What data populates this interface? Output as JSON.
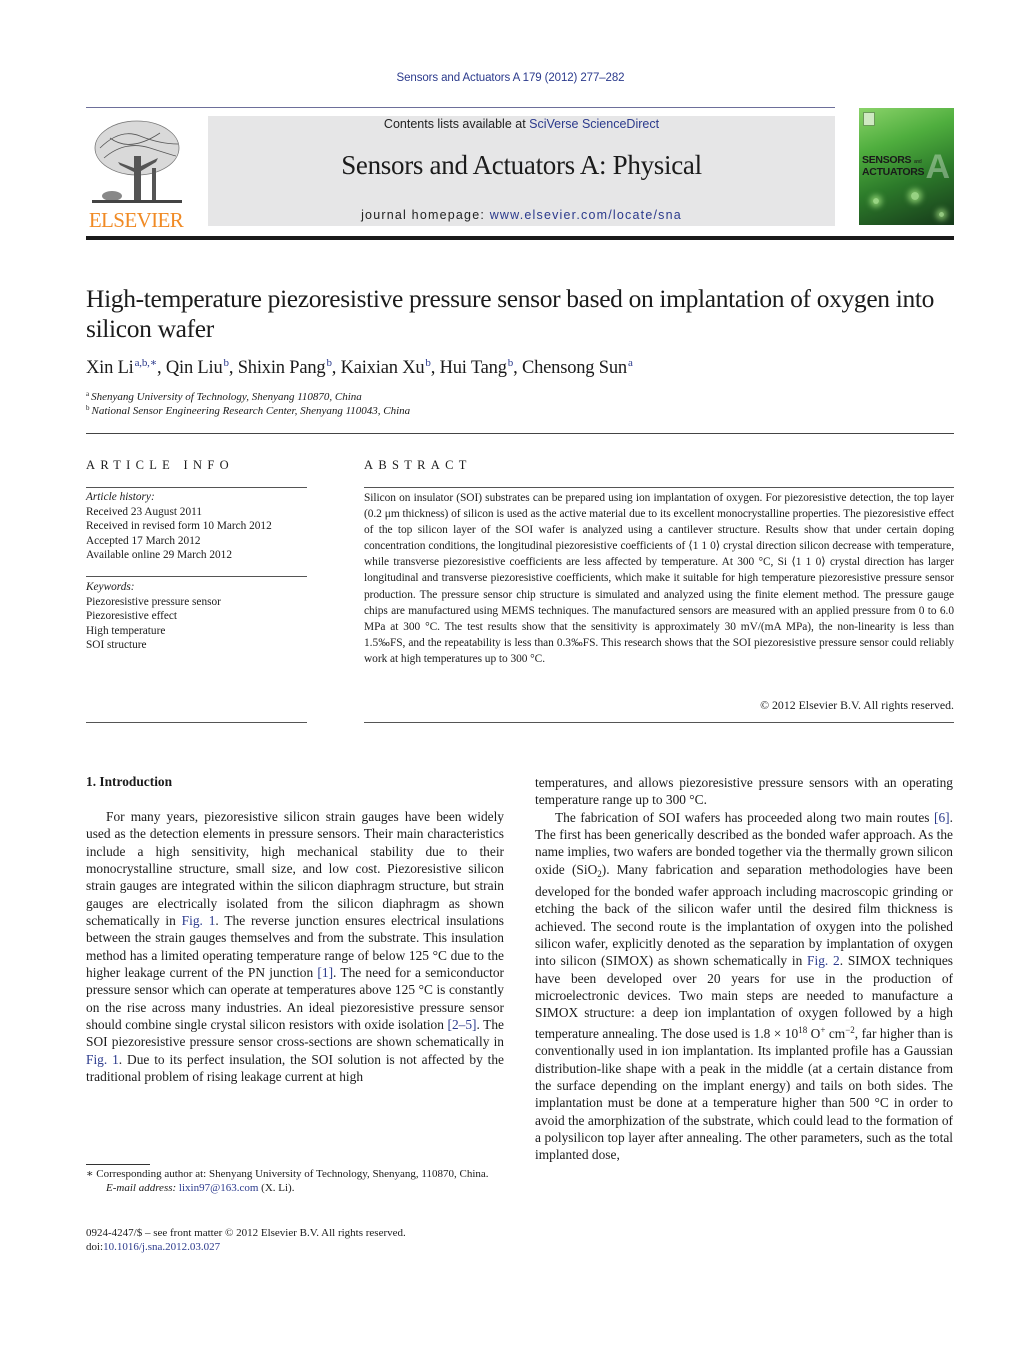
{
  "running_head": "Sensors and Actuators A 179 (2012) 277–282",
  "masthead": {
    "contents_prefix": "Contents lists available at ",
    "contents_link": "SciVerse ScienceDirect",
    "journal_title": "Sensors and Actuators A: Physical",
    "homepage_prefix": "journal homepage: ",
    "homepage_link": "www.elsevier.com/locate/sna",
    "publisher_wordmark": "ELSEVIER",
    "cover": {
      "line1": "SENSORS",
      "and": "and",
      "line2": "ACTUATORS",
      "letter": "A"
    }
  },
  "colors": {
    "link": "#2b3a8c",
    "elsevier_orange": "#f08a24",
    "masthead_bg": "#e6e6e7",
    "cover_green": "#4fae3e"
  },
  "article": {
    "title": "High-temperature piezoresistive pressure sensor based on implantation of oxygen into silicon wafer",
    "authors": [
      {
        "name": "Xin Li",
        "sup": "a,b,∗"
      },
      {
        "name": "Qin Liu",
        "sup": "b"
      },
      {
        "name": "Shixin Pang",
        "sup": "b"
      },
      {
        "name": "Kaixian Xu",
        "sup": "b"
      },
      {
        "name": "Hui Tang",
        "sup": "b"
      },
      {
        "name": "Chensong Sun",
        "sup": "a"
      }
    ],
    "affiliations": [
      {
        "mark": "a",
        "text": "Shenyang University of Technology, Shenyang 110870, China"
      },
      {
        "mark": "b",
        "text": "National Sensor Engineering Research Center, Shenyang 110043, China"
      }
    ]
  },
  "article_info": {
    "heading": "ARTICLE INFO",
    "history_label": "Article history:",
    "history": [
      "Received 23 August 2011",
      "Received in revised form 10 March 2012",
      "Accepted 17 March 2012",
      "Available online 29 March 2012"
    ],
    "keywords_label": "Keywords:",
    "keywords": [
      "Piezoresistive pressure sensor",
      "Piezoresistive effect",
      "High temperature",
      "SOI structure"
    ]
  },
  "abstract": {
    "heading": "ABSTRACT",
    "text": "Silicon on insulator (SOI) substrates can be prepared using ion implantation of oxygen. For piezoresistive detection, the top layer (0.2 μm thickness) of silicon is used as the active material due to its excellent monocrystalline properties. The piezoresistive effect of the top silicon layer of the SOI wafer is analyzed using a cantilever structure. Results show that under certain doping concentration conditions, the longitudinal piezoresistive coefficients of ⟨1 1 0⟩ crystal direction silicon decrease with temperature, while transverse piezoresistive coefficients are less affected by temperature. At 300 °C, Si ⟨1 1 0⟩ crystal direction has larger longitudinal and transverse piezoresistive coefficients, which make it suitable for high temperature piezoresistive pressure sensor production. The pressure sensor chip structure is simulated and analyzed using the finite element method. The pressure gauge chips are manufactured using MEMS techniques. The manufactured sensors are measured with an applied pressure from 0 to 6.0 MPa at 300 °C. The test results show that the sensitivity is approximately 30 mV/(mA MPa), the non-linearity is less than 1.5‰FS, and the repeatability is less than 0.3‰FS. This research shows that the SOI piezoresistive pressure sensor could reliably work at high temperatures up to 300 °C.",
    "copyright": "© 2012 Elsevier B.V. All rights reserved."
  },
  "body": {
    "section_heading": "1.  Introduction",
    "left_p1_a": "For many years, piezoresistive silicon strain gauges have been widely used as the detection elements in pressure sensors. Their main characteristics include a high sensitivity, high mechanical stability due to their monocrystalline structure, small size, and low cost. Piezoresistive silicon strain gauges are integrated within the silicon diaphragm structure, but strain gauges are electrically isolated from the silicon diaphragm as shown schematically in ",
    "ref_fig1": "Fig. 1",
    "left_p1_b": ". The reverse junction ensures electrical insulations between the strain gauges themselves and from the substrate. This insulation method has a limited operating temperature range of below 125 °C due to the higher leakage current of the PN junction ",
    "ref_1": "[1]",
    "left_p1_c": ". The need for a semiconductor pressure sensor which can operate at temperatures above 125 °C is constantly on the rise across many industries. An ideal piezoresistive pressure sensor should combine single crystal silicon resistors with oxide isolation ",
    "ref_2_5": "[2–5]",
    "left_p1_d": ". The SOI piezoresistive pressure sensor cross-sections are shown schematically in ",
    "left_p1_e": ". Due to its perfect insulation, the SOI solution is not affected by the traditional problem of rising leakage current at high",
    "right_p0": "temperatures, and allows piezoresistive pressure sensors with an operating temperature range up to 300 °C.",
    "right_p1_a": "The fabrication of SOI wafers has proceeded along two main routes ",
    "ref_6": "[6]",
    "right_p1_b": ". The first has been generically described as the bonded wafer approach. As the name implies, two wafers are bonded together via the thermally grown silicon oxide (SiO",
    "sub_2": "2",
    "right_p1_c": "). Many fabrication and separation methodologies have been developed for the bonded wafer approach including macroscopic grinding or etching the back of the silicon wafer until the desired film thickness is achieved. The second route is the implantation of oxygen into the polished silicon wafer, explicitly denoted as the separation by implantation of oxygen into silicon (SIMOX) as shown schematically in ",
    "ref_fig2": "Fig. 2",
    "right_p1_d": ". SIMOX techniques have been developed over 20 years for use in the production of microelectronic devices. Two main steps are needed to manufacture a SIMOX structure: a deep ion implantation of oxygen followed by a high temperature annealing. The dose used is 1.8 × 10",
    "exp_18": "18",
    "dose_unit_a": " O",
    "sup_plus": "+",
    "dose_unit_b": " cm",
    "exp_minus2": "−2",
    "right_p1_e": ", far higher than is conventionally used in ion implantation. Its implanted profile has a Gaussian distribution-like shape with a peak in the middle (at a certain distance from the surface depending on the implant energy) and tails on both sides. The implantation must be done at a temperature higher than 500 °C in order to avoid the amorphization of the substrate, which could lead to the formation of a polysilicon top layer after annealing. The other parameters, such as the total implanted dose,"
  },
  "footnotes": {
    "corresponding": "∗ Corresponding author at: Shenyang University of Technology, Shenyang, 110870, China.",
    "email_label": "E-mail address: ",
    "email": "lixin97@163.com",
    "email_suffix": " (X. Li).",
    "front_matter": "0924-4247/$ – see front matter © 2012 Elsevier B.V. All rights reserved.",
    "doi_prefix": "doi:",
    "doi": "10.1016/j.sna.2012.03.027"
  }
}
